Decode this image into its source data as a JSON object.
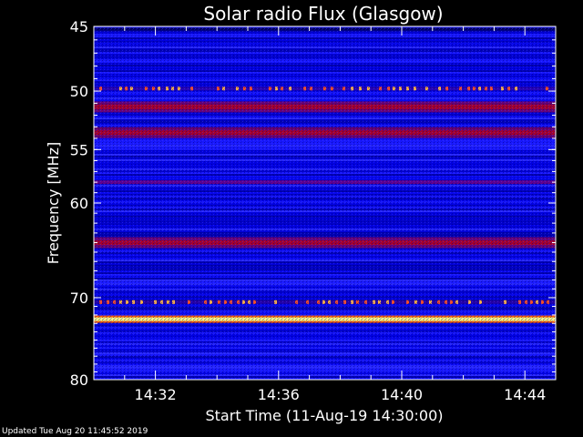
{
  "chart_data": {
    "type": "heatmap",
    "title": "Solar radio Flux (Glasgow)",
    "xlabel": "Start Time (11-Aug-19 14:30:00)",
    "ylabel": "Frequency [MHz]",
    "x_tick_labels": [
      "14:32",
      "14:36",
      "14:40",
      "14:44"
    ],
    "x_ticks_minutes": [
      2,
      6,
      10,
      14
    ],
    "xlim_minutes": [
      0,
      15
    ],
    "y_tick_labels": [
      "45",
      "50",
      "55",
      "60",
      "70",
      "80"
    ],
    "y_ticks": [
      45,
      50,
      55,
      60,
      70,
      80
    ],
    "ylim": [
      45,
      80
    ],
    "y_scale": "log",
    "colormap": [
      "#0000a0",
      "#0000ff",
      "#3030ff",
      "#8000a0",
      "#c00000",
      "#ff8040",
      "#ffffc0"
    ],
    "bands_mhz": [
      {
        "freq": 45.2,
        "level": "dark"
      },
      {
        "freq": 49.8,
        "level": "bursty"
      },
      {
        "freq": 51.3,
        "level": "red"
      },
      {
        "freq": 53.5,
        "level": "red"
      },
      {
        "freq": 58.0,
        "level": "purple"
      },
      {
        "freq": 64.0,
        "level": "red"
      },
      {
        "freq": 70.5,
        "level": "bursty"
      },
      {
        "freq": 72.5,
        "level": "saturated"
      }
    ]
  },
  "footer": {
    "updated": "Updated Tue Aug 20 11:45:52 2019"
  }
}
